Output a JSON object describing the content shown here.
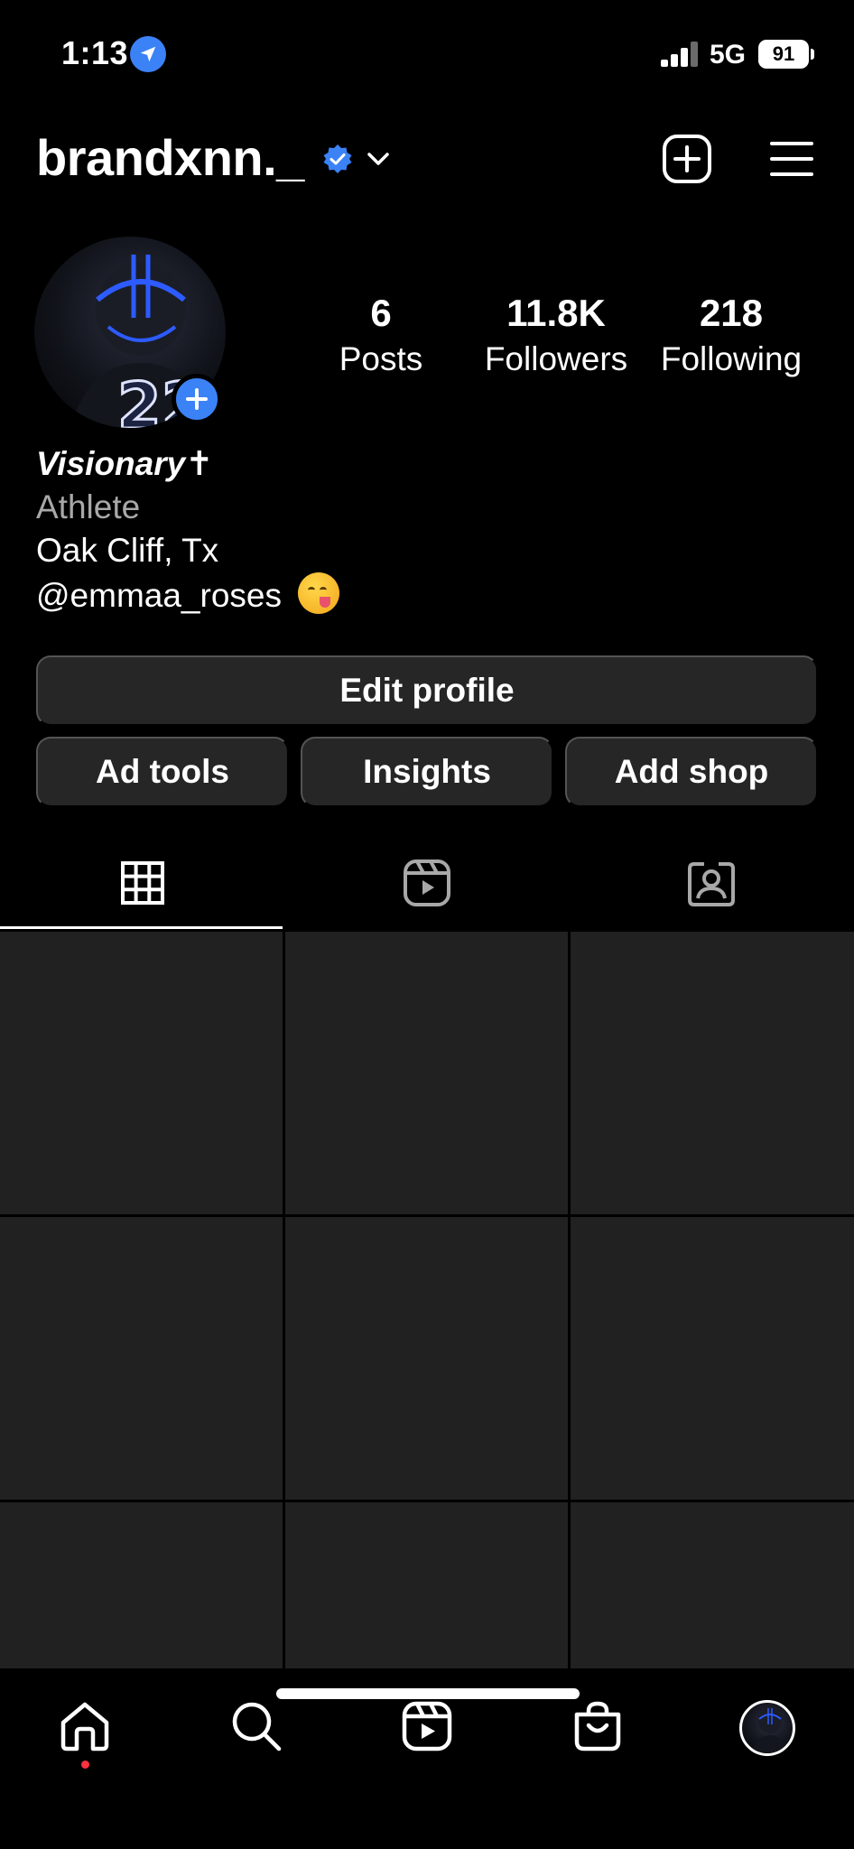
{
  "status_bar": {
    "time": "1:13",
    "network": "5G",
    "battery": "91"
  },
  "header": {
    "username": "brandxnn._"
  },
  "profile": {
    "stats": [
      {
        "value": "6",
        "label": "Posts"
      },
      {
        "value": "11.8K",
        "label": "Followers"
      },
      {
        "value": "218",
        "label": "Following"
      }
    ],
    "bio": {
      "name": "Visionary✝",
      "category": "Athlete",
      "location": "Oak Cliff, Tx",
      "mention": "@emmaa_roses"
    }
  },
  "buttons": {
    "edit_profile": "Edit profile",
    "ad_tools": "Ad tools",
    "insights": "Insights",
    "add_shop": "Add shop"
  },
  "tabs": [
    {
      "icon": "grid-icon",
      "active": true
    },
    {
      "icon": "reels-icon",
      "active": false
    },
    {
      "icon": "tagged-icon",
      "active": false
    }
  ],
  "bottom_nav": [
    {
      "icon": "home-icon"
    },
    {
      "icon": "search-icon"
    },
    {
      "icon": "reels-icon"
    },
    {
      "icon": "shop-icon"
    },
    {
      "icon": "profile-avatar"
    }
  ],
  "colors": {
    "background": "#000000",
    "button_bg": "#262626",
    "grid_cell": "#212121",
    "accent_blue": "#3b82f6",
    "secondary_text": "#a8a8a8",
    "notification_dot": "#ff3040"
  }
}
